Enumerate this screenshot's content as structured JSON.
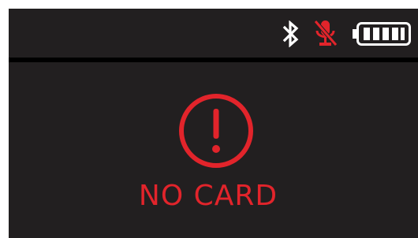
{
  "status_bar": {
    "icons": [
      "bluetooth-icon",
      "microphone-muted-icon",
      "battery-full-icon"
    ],
    "battery_level": 1.0,
    "microphone_muted": true
  },
  "main": {
    "alert_icon": "exclamation-circle-icon",
    "message": "NO CARD"
  },
  "colors": {
    "background": "#221f20",
    "divider": "#000000",
    "accent": "#e2242b",
    "icon": "#ffffff"
  }
}
